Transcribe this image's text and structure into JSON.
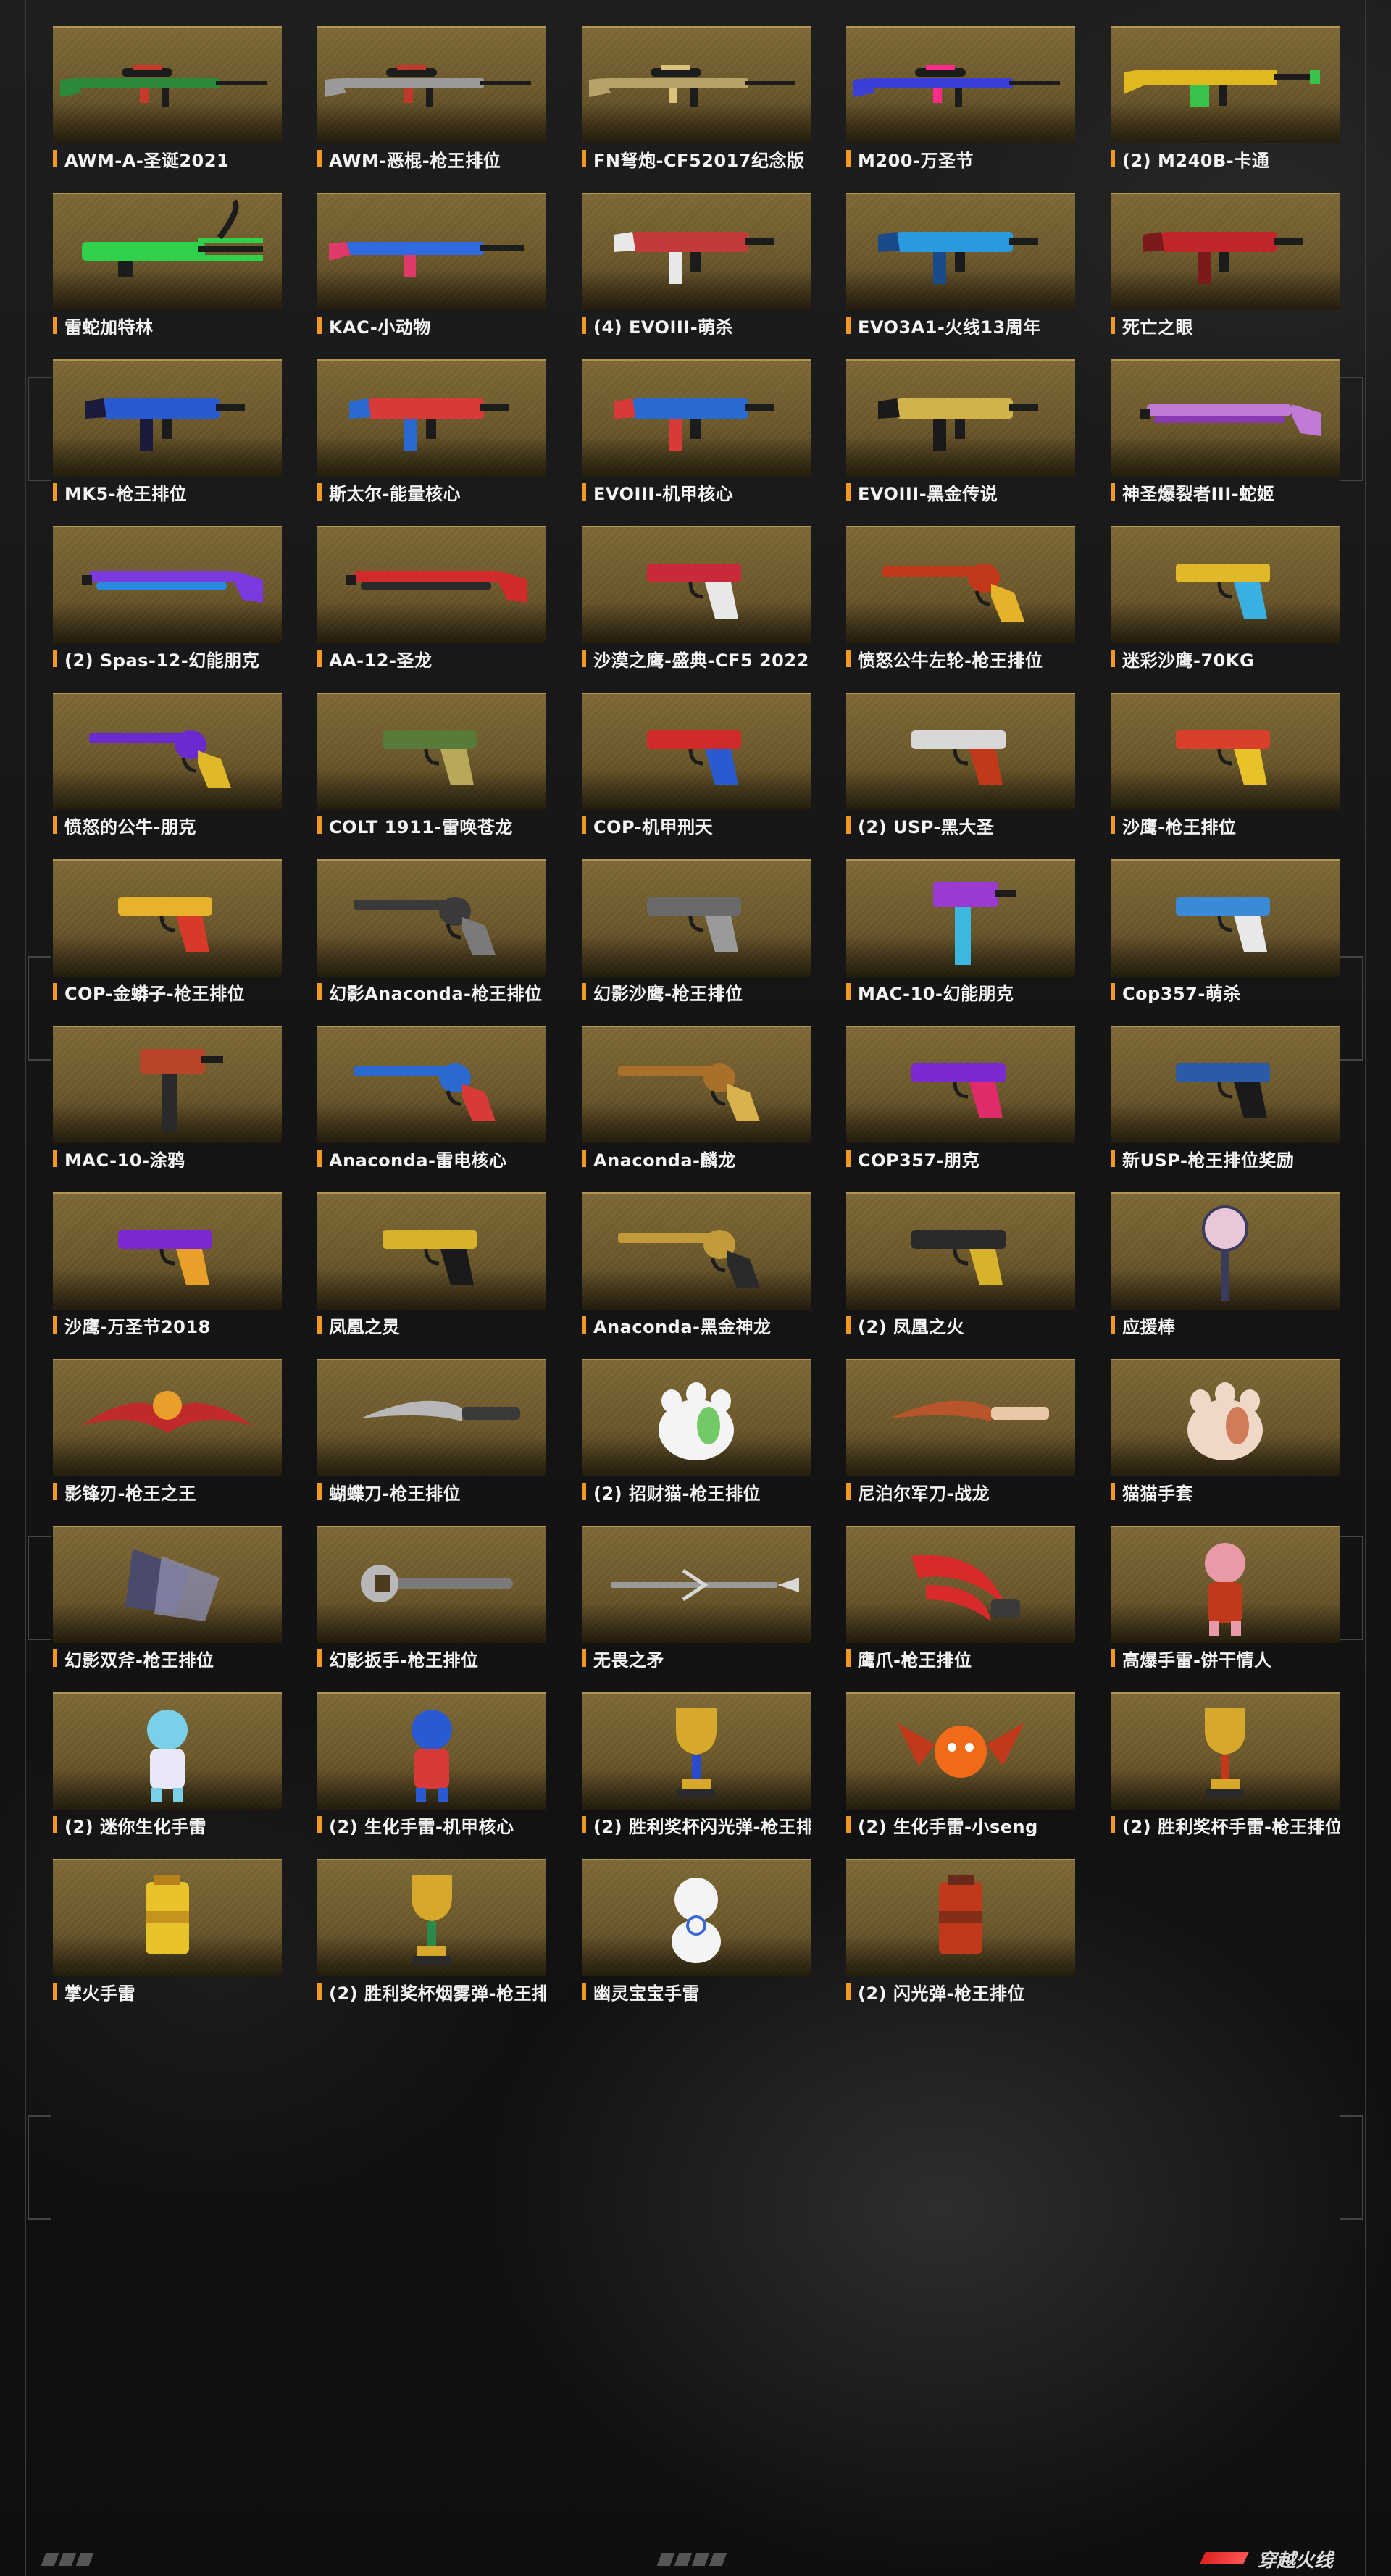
{
  "items": [
    {
      "label": "AWM-A-圣诞2021",
      "kind": "sniper",
      "color": "#2a8a3a",
      "accent": "#c63a2a"
    },
    {
      "label": "AWM-恶棍-枪王排位",
      "kind": "sniper",
      "color": "#9a9a9a",
      "accent": "#c0392b"
    },
    {
      "label": "FN弩炮-CF52017纪念版",
      "kind": "sniper",
      "color": "#b6a36a",
      "accent": "#d9c27a"
    },
    {
      "label": "M200-万圣节",
      "kind": "sniper",
      "color": "#3b3fd6",
      "accent": "#ff2a8a"
    },
    {
      "label": "(2) M240B-卡通",
      "kind": "mg",
      "color": "#e0b820",
      "accent": "#39c24a"
    },
    {
      "label": "雷蛇加特林",
      "kind": "gatling",
      "color": "#2fd04a",
      "accent": "#1a1a1a"
    },
    {
      "label": "KAC-小动物",
      "kind": "rifle",
      "color": "#2f6ae0",
      "accent": "#e03a6a"
    },
    {
      "label": "(4) EVOIII-萌杀",
      "kind": "smg",
      "color": "#c23a3a",
      "accent": "#e8e8e8"
    },
    {
      "label": "EVO3A1-火线13周年",
      "kind": "smg",
      "color": "#2a9ae0",
      "accent": "#1a4a8a"
    },
    {
      "label": "死亡之眼",
      "kind": "smg",
      "color": "#c0252a",
      "accent": "#7a1a1a"
    },
    {
      "label": "MK5-枪王排位",
      "kind": "smg",
      "color": "#2a5ad0",
      "accent": "#1a1a3a"
    },
    {
      "label": "斯太尔-能量核心",
      "kind": "smg",
      "color": "#d83a3a",
      "accent": "#2a6ad0"
    },
    {
      "label": "EVOIII-机甲核心",
      "kind": "smg",
      "color": "#2a6ad0",
      "accent": "#d83a3a"
    },
    {
      "label": "EVOIII-黑金传说",
      "kind": "smg",
      "color": "#d2b24a",
      "accent": "#1a1a1a"
    },
    {
      "label": "神圣爆裂者III-蛇姬",
      "kind": "shotgun",
      "color": "#c07ad8",
      "accent": "#8a3ab0"
    },
    {
      "label": "(2) Spas-12-幻能朋克",
      "kind": "shotgun",
      "color": "#7a3ae0",
      "accent": "#2a8ae0"
    },
    {
      "label": "AA-12-圣龙",
      "kind": "shotgun",
      "color": "#d02a2a",
      "accent": "#2a2a2a"
    },
    {
      "label": "沙漠之鹰-盛典-CF5 2022",
      "kind": "pistol",
      "color": "#c82a3a",
      "accent": "#e8e8e8"
    },
    {
      "label": "愤怒公牛左轮-枪王排位",
      "kind": "revolver",
      "color": "#c2381a",
      "accent": "#e6b22a"
    },
    {
      "label": "迷彩沙鹰-70KG",
      "kind": "pistol",
      "color": "#e0b82a",
      "accent": "#3ab0e0"
    },
    {
      "label": "愤怒的公牛-朋克",
      "kind": "revolver",
      "color": "#6a2ad0",
      "accent": "#e0b82a"
    },
    {
      "label": "COLT 1911-雷唤苍龙",
      "kind": "pistol",
      "color": "#5a7a3a",
      "accent": "#b8a85a"
    },
    {
      "label": "COP-机甲刑天",
      "kind": "pistol",
      "color": "#d02a2a",
      "accent": "#2a5ad0"
    },
    {
      "label": "(2) USP-黑大圣",
      "kind": "pistol",
      "color": "#d8d8d8",
      "accent": "#c2381a"
    },
    {
      "label": "沙鹰-枪王排位",
      "kind": "pistol",
      "color": "#d8402a",
      "accent": "#e8c22a"
    },
    {
      "label": "COP-金蟒子-枪王排位",
      "kind": "pistol",
      "color": "#e8b22a",
      "accent": "#d83a2a"
    },
    {
      "label": "幻影Anaconda-枪王排位",
      "kind": "revolver",
      "color": "#3a3a3a",
      "accent": "#7a7a7a"
    },
    {
      "label": "幻影沙鹰-枪王排位",
      "kind": "pistol",
      "color": "#6a6a6a",
      "accent": "#9a9a9a"
    },
    {
      "label": "MAC-10-幻能朋克",
      "kind": "mac",
      "color": "#9a3ad0",
      "accent": "#3ab8e0"
    },
    {
      "label": "Cop357-萌杀",
      "kind": "pistol",
      "color": "#3a8ad8",
      "accent": "#e8e8e8"
    },
    {
      "label": "MAC-10-涂鸦",
      "kind": "mac",
      "color": "#b8452a",
      "accent": "#2a2a2a"
    },
    {
      "label": "Anaconda-雷电核心",
      "kind": "revolver",
      "color": "#2a6ad0",
      "accent": "#d83a3a"
    },
    {
      "label": "Anaconda-麟龙",
      "kind": "revolver",
      "color": "#a8702a",
      "accent": "#d8b24a"
    },
    {
      "label": "COP357-朋克",
      "kind": "pistol",
      "color": "#7a2ad0",
      "accent": "#e02a6a"
    },
    {
      "label": "新USP-枪王排位奖励",
      "kind": "pistol",
      "color": "#2a5aa8",
      "accent": "#1a1a1a"
    },
    {
      "label": "沙鹰-万圣节2018",
      "kind": "pistol",
      "color": "#7a2ad0",
      "accent": "#e8a02a"
    },
    {
      "label": "凤凰之灵",
      "kind": "pistol",
      "color": "#d8b22a",
      "accent": "#1a1a1a"
    },
    {
      "label": "Anaconda-黑金神龙",
      "kind": "revolver",
      "color": "#c29a3a",
      "accent": "#2a2a2a"
    },
    {
      "label": "(2) 凤凰之火",
      "kind": "pistol",
      "color": "#2a2a2a",
      "accent": "#d8b22a"
    },
    {
      "label": "应援棒",
      "kind": "stick",
      "color": "#e8c8d8",
      "accent": "#3a3a5a"
    },
    {
      "label": "影锋刃-枪王之王",
      "kind": "blade",
      "color": "#c02a2a",
      "accent": "#e8a02a"
    },
    {
      "label": "蝴蝶刀-枪王排位",
      "kind": "knife",
      "color": "#b8b8b8",
      "accent": "#3a3a3a"
    },
    {
      "label": "(2) 招财猫-枪王排位",
      "kind": "paw",
      "color": "#f4f4f4",
      "accent": "#3ab82a"
    },
    {
      "label": "尼泊尔军刀-战龙",
      "kind": "knife",
      "color": "#b8552a",
      "accent": "#e8c8a8"
    },
    {
      "label": "猫猫手套",
      "kind": "paw",
      "color": "#f0d8c8",
      "accent": "#c2552a"
    },
    {
      "label": "幻影双斧-枪王排位",
      "kind": "axe",
      "color": "#4a4a6a",
      "accent": "#8a8aaa"
    },
    {
      "label": "幻影扳手-枪王排位",
      "kind": "wrench",
      "color": "#7a7a7a",
      "accent": "#b8b8b8"
    },
    {
      "label": "无畏之矛",
      "kind": "spear",
      "color": "#9a9a9a",
      "accent": "#d8d8d8"
    },
    {
      "label": "鹰爪-枪王排位",
      "kind": "claw",
      "color": "#d82a2a",
      "accent": "#3a3a3a"
    },
    {
      "label": "高爆手雷-饼干情人",
      "kind": "doll",
      "color": "#e89aa8",
      "accent": "#c2381a"
    },
    {
      "label": "(2) 迷你生化手雷",
      "kind": "doll",
      "color": "#7ad0e8",
      "accent": "#e8e8f8"
    },
    {
      "label": "(2) 生化手雷-机甲核心",
      "kind": "doll",
      "color": "#2a5ad0",
      "accent": "#d83a3a"
    },
    {
      "label": "(2) 胜利奖杯闪光弹-枪王排",
      "kind": "trophy",
      "color": "#d8a82a",
      "accent": "#2a4ad0"
    },
    {
      "label": "(2) 生化手雷-小seng",
      "kind": "bat",
      "color": "#f06a1a",
      "accent": "#c2381a"
    },
    {
      "label": "(2) 胜利奖杯手雷-枪王排位",
      "kind": "trophy",
      "color": "#d8a82a",
      "accent": "#c2381a"
    },
    {
      "label": "掌火手雷",
      "kind": "can",
      "color": "#e8c22a",
      "accent": "#b8801a"
    },
    {
      "label": "(2) 胜利奖杯烟雾弹-枪王排",
      "kind": "trophy",
      "color": "#d8a82a",
      "accent": "#2a8a4a"
    },
    {
      "label": "幽灵宝宝手雷",
      "kind": "ghost",
      "color": "#f4f4f4",
      "accent": "#3a6ad0"
    },
    {
      "label": "(2) 闪光弹-枪王排位",
      "kind": "can",
      "color": "#c2381a",
      "accent": "#6a2a1a"
    }
  ],
  "logo_text": "穿越火线",
  "colors": {
    "label_bar": "#f29a1f",
    "card_top": "#7b6735",
    "card_bottom": "#4a3c1c"
  }
}
